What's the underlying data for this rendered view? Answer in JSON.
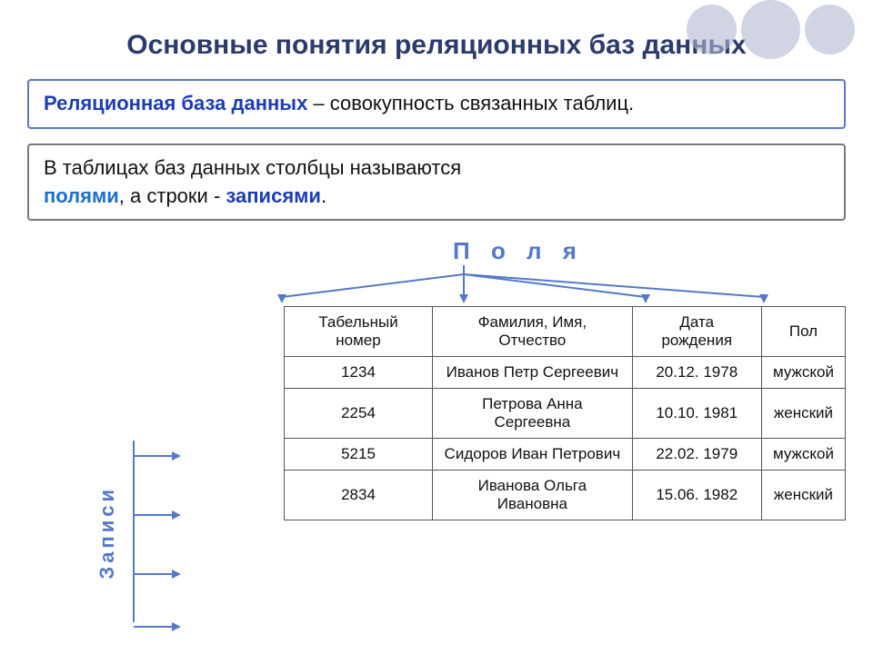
{
  "title": "Основные понятия реляционных баз данных",
  "definition": {
    "term": "Реляционная база данных",
    "rest": " – совокупность связанных таблиц."
  },
  "info_text": {
    "line1": "В таблицах баз данных столбцы называются",
    "highlight1": "полями",
    "middle": ", а строки - ",
    "highlight2": "записями",
    "end": "."
  },
  "polya_label": "П о л я",
  "zapisi_label": "Записи",
  "table": {
    "headers": [
      "Табельный номер",
      "Фамилия, Имя, Отчество",
      "Дата рождения",
      "Пол"
    ],
    "rows": [
      [
        "1234",
        "Иванов Петр Сергеевич",
        "20.12. 1978",
        "мужской"
      ],
      [
        "2254",
        "Петрова Анна Сергеевна",
        "10.10. 1981",
        "женский"
      ],
      [
        "5215",
        "Сидоров Иван Петрович",
        "22.02. 1979",
        "мужской"
      ],
      [
        "2834",
        "Иванова Ольга Ивановна",
        "15.06. 1982",
        "женский"
      ]
    ]
  },
  "colors": {
    "accent_blue": "#5578c8",
    "dark_blue": "#2c3a6e",
    "link_blue": "#1a6ecc"
  }
}
